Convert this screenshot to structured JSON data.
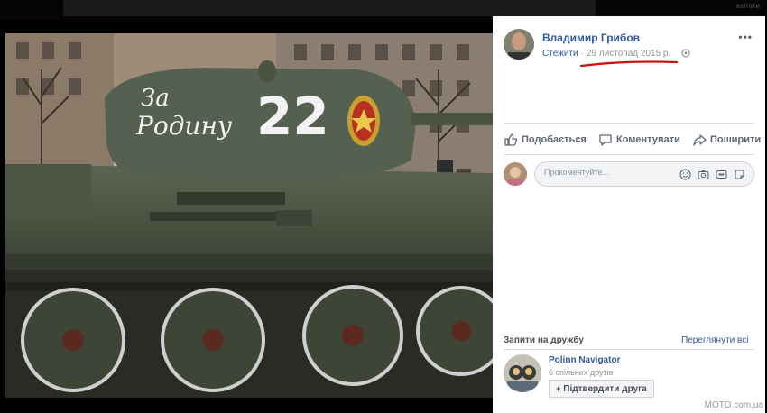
{
  "topbar": {
    "corner_text": "вхітати"
  },
  "post": {
    "photo_text": {
      "line1": "За",
      "line2": "Родину",
      "number": "22"
    },
    "author": "Владимир Грибов",
    "follow_label": "Стежити",
    "date": "29 листопад 2015 р.",
    "more": "•••"
  },
  "actions": {
    "like": "Подобається",
    "comment": "Коментувати",
    "share": "Поширити"
  },
  "comment": {
    "placeholder": "Прокоментуйте..."
  },
  "friends": {
    "title": "Запити на дружбу",
    "see_all": "Переглянути всі",
    "request": {
      "name": "Polinn Navigator",
      "mutual": "6 спільних друзів",
      "confirm": "Підтвердити друга"
    }
  },
  "watermark": "MOTO.com.ua",
  "colors": {
    "link": "#365899",
    "underline_mark": "#cc1111",
    "tank": "#4a5441"
  }
}
